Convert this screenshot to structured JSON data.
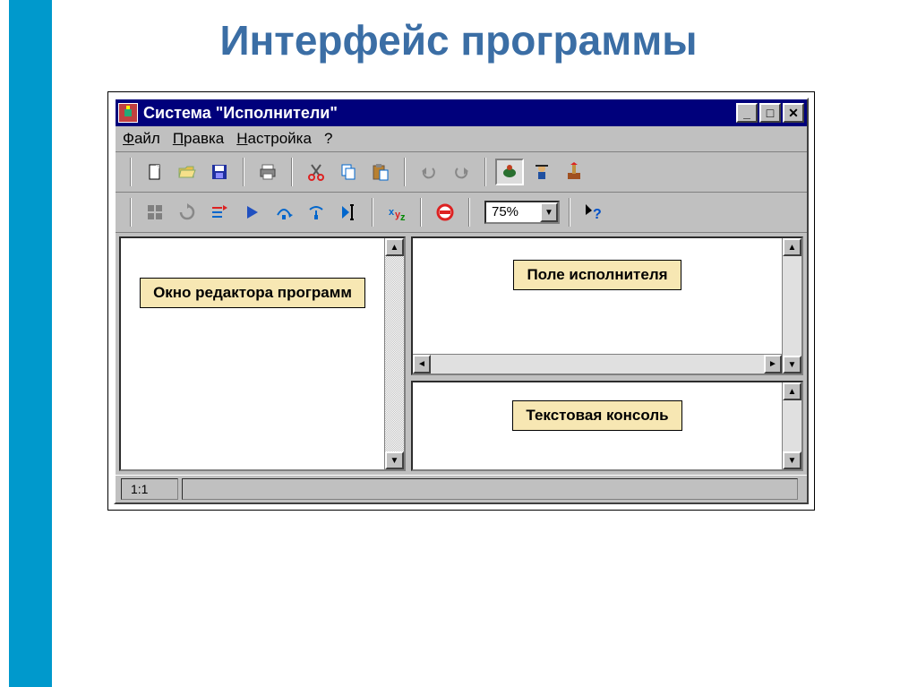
{
  "page": {
    "title": "Интерфейс программы"
  },
  "window": {
    "title": "Система \"Исполнители\"",
    "controls": {
      "min": "_",
      "max": "□",
      "close": "✕"
    }
  },
  "menu": {
    "file": "Файл",
    "edit": "Правка",
    "settings": "Настройка",
    "help": "?"
  },
  "toolbar1": {
    "new": "new-icon",
    "open": "open-icon",
    "save": "save-icon",
    "print": "print-icon",
    "cut": "cut-icon",
    "copy": "copy-icon",
    "paste": "paste-icon",
    "undo": "undo-icon",
    "redo": "redo-icon",
    "turtle": "turtle-icon",
    "robot": "robot-icon",
    "flag": "flag-icon"
  },
  "toolbar2": {
    "grid": "grid-icon",
    "refresh": "refresh-icon",
    "step": "step-icon",
    "run": "run-icon",
    "stepover1": "step-over-icon",
    "stepover2": "step-into-icon",
    "cursor": "cursor-icon",
    "xyz": "xyz-icon",
    "stop": "stop-icon",
    "zoom_value": "75%",
    "pointer_help": "pointer-help-icon"
  },
  "panes": {
    "editor_label": "Окно редактора программ",
    "field_label": "Поле исполнителя",
    "console_label": "Текстовая консоль"
  },
  "statusbar": {
    "pos": "1:1"
  }
}
